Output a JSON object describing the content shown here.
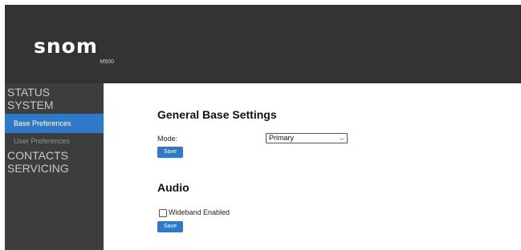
{
  "header": {
    "logo_text": "snom",
    "model": "M500"
  },
  "sidebar": {
    "sections": [
      {
        "label": "STATUS"
      },
      {
        "label": "SYSTEM",
        "items": [
          {
            "label": "Base Preferences",
            "active": true
          },
          {
            "label": "User Preferences",
            "active": false
          }
        ]
      },
      {
        "label": "CONTACTS"
      },
      {
        "label": "SERVICING"
      }
    ]
  },
  "general": {
    "title": "General Base Settings",
    "mode_label": "Mode:",
    "mode_value": "Primary",
    "save_label": "Save"
  },
  "audio": {
    "title": "Audio",
    "wideband_label": "Wideband Enabled",
    "wideband_checked": false,
    "save_label": "Save"
  },
  "colors": {
    "header_bg": "#333333",
    "sidebar_bg": "#3d3d3d",
    "accent": "#2f79c9"
  }
}
